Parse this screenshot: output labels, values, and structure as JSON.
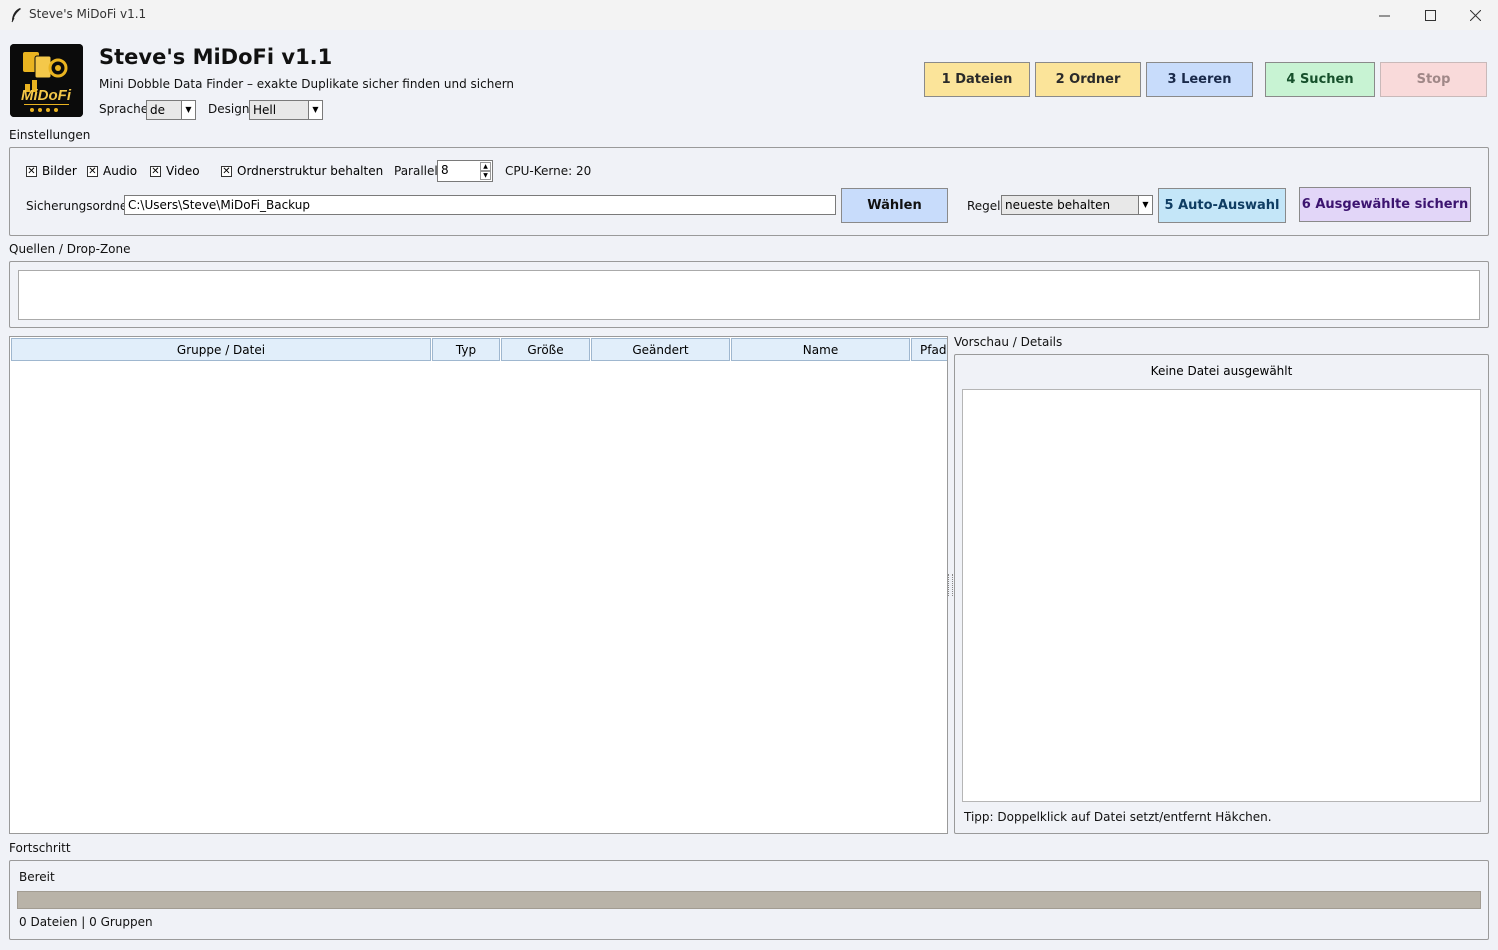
{
  "window": {
    "title": "Steve's MiDoFi v1.1",
    "minimize_icon": "minimize-icon",
    "maximize_icon": "maximize-icon",
    "close_icon": "close-icon"
  },
  "header": {
    "title": "Steve's MiDoFi v1.1",
    "subtitle": "Mini Dobble Data Finder – exakte Duplikate sicher finden und sichern",
    "logo_text": "MiDoFi",
    "language_label": "Sprache",
    "language_value": "de",
    "design_label": "Design",
    "design_value": "Hell"
  },
  "toolbar": {
    "files": "1 Dateien",
    "folder": "2 Ordner",
    "clear": "3 Leeren",
    "search": "4 Suchen",
    "stop": "Stop"
  },
  "settings": {
    "label": "Einstellungen",
    "images": "Bilder",
    "audio": "Audio",
    "video": "Video",
    "keep_structure": "Ordnerstruktur behalten",
    "parallel_label": "Parallel",
    "parallel_value": "8",
    "cpu_cores": "CPU-Kerne: 20",
    "backup_label": "Sicherungsordner",
    "backup_path": "C:\\Users\\Steve\\MiDoFi_Backup",
    "choose_button": "Wählen",
    "rule_label": "Regel",
    "rule_value": "neueste behalten",
    "auto_select": "5 Auto-Auswahl",
    "save_selected": "6 Ausgewählte sichern"
  },
  "sources": {
    "label": "Quellen / Drop-Zone"
  },
  "table": {
    "columns": [
      "Gruppe / Datei",
      "Typ",
      "Größe",
      "Geändert",
      "Name",
      "Pfadl"
    ]
  },
  "preview": {
    "label": "Vorschau / Details",
    "no_file": "Keine Datei ausgewählt",
    "tip": "Tipp: Doppelklick auf Datei setzt/entfernt Häkchen."
  },
  "progress": {
    "label": "Fortschritt",
    "status": "Bereit",
    "progress_fraction": 0,
    "summary": "0 Dateien | 0 Gruppen"
  },
  "colors": {
    "files_button": "#fbe49a",
    "folder_button": "#fbe49a",
    "clear_button": "#c8dcfb",
    "search_button": "#c8f3d3",
    "stop_button": "#f9dada",
    "choose_button": "#c8dcfb",
    "auto_select_button": "#c4e6f8",
    "save_selected_button": "#e2d6f8"
  }
}
